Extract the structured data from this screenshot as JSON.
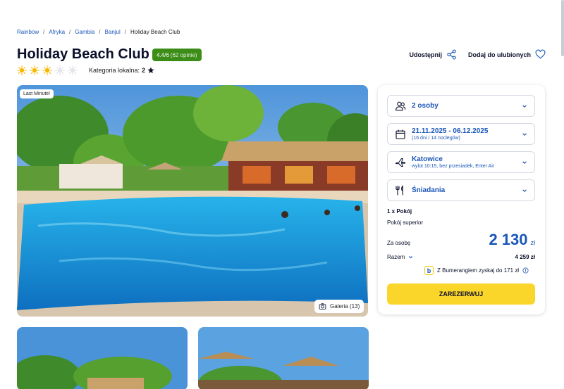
{
  "breadcrumb": [
    "Rainbow",
    "Afryka",
    "Gambia",
    "Banjul",
    "Holiday Beach Club"
  ],
  "hotel": {
    "title": "Holiday Beach Club",
    "rating": "4.4/6",
    "reviews": "(62 opinie)",
    "suns_filled": 3,
    "suns_total": 5,
    "local_category_label": "Kategoria lokalna:",
    "local_category_value": "2"
  },
  "actions": {
    "share": "Udostępnij",
    "favorite": "Dodaj do ulubionych"
  },
  "gallery": {
    "badge": "Last Minute!",
    "button": "Galeria (13)"
  },
  "booking": {
    "persons": "2 osoby",
    "dates": "21.11.2025 - 06.12.2025",
    "dates_sub": "(16 dni / 14 noclegów)",
    "departure": "Katowice",
    "departure_sub": "wylot 10:15, bez przesiadek, Enter Air",
    "board": "Śniadania",
    "room_count": "1 x Pokój",
    "room_type": "Pokój superior",
    "per_person_label": "Za osobę",
    "price": "2 130",
    "currency": "zł",
    "total_label": "Razem",
    "total_value": "4 259 zł",
    "boomerang_text": "Z Bumerangiem zyskaj do 171 zł",
    "book_button": "ZAREZERWUJ"
  },
  "colors": {
    "accent": "#1a56b8",
    "cta": "#fbd62a",
    "rating": "#3c8d17",
    "sun": "#f5b800"
  }
}
